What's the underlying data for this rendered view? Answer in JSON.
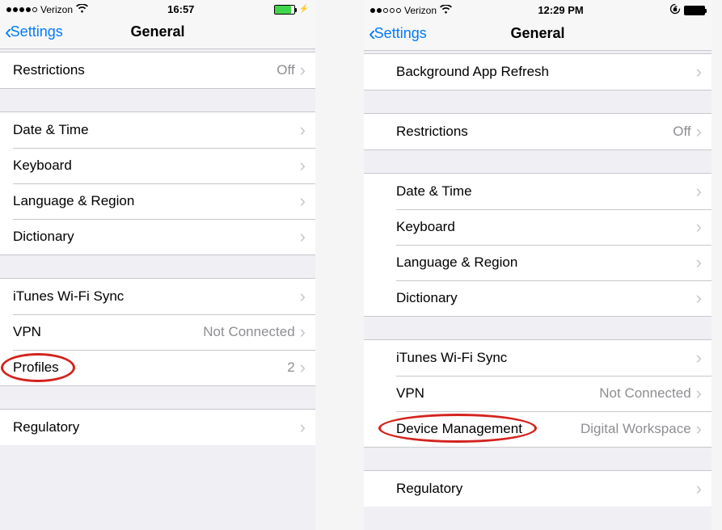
{
  "left": {
    "status": {
      "carrier": "Verizon",
      "time": "16:57",
      "signal_filled": 4
    },
    "nav": {
      "back": "Settings",
      "title": "General"
    },
    "groups": [
      [
        {
          "label": "Restrictions",
          "detail": "Off"
        }
      ],
      [
        {
          "label": "Date & Time"
        },
        {
          "label": "Keyboard"
        },
        {
          "label": "Language & Region"
        },
        {
          "label": "Dictionary"
        }
      ],
      [
        {
          "label": "iTunes Wi-Fi Sync"
        },
        {
          "label": "VPN",
          "detail": "Not Connected"
        },
        {
          "label": "Profiles",
          "detail": "2",
          "highlight": true
        }
      ],
      [
        {
          "label": "Regulatory"
        }
      ]
    ]
  },
  "right": {
    "status": {
      "carrier": "Verizon",
      "time": "12:29 PM",
      "signal_filled": 2
    },
    "nav": {
      "back": "Settings",
      "title": "General"
    },
    "groups": [
      [
        {
          "label": "Background App Refresh"
        }
      ],
      [
        {
          "label": "Restrictions",
          "detail": "Off"
        }
      ],
      [
        {
          "label": "Date & Time"
        },
        {
          "label": "Keyboard"
        },
        {
          "label": "Language & Region"
        },
        {
          "label": "Dictionary"
        }
      ],
      [
        {
          "label": "iTunes Wi-Fi Sync"
        },
        {
          "label": "VPN",
          "detail": "Not Connected"
        },
        {
          "label": "Device Management",
          "detail": "Digital Workspace",
          "highlight": true
        }
      ],
      [
        {
          "label": "Regulatory"
        }
      ]
    ]
  }
}
